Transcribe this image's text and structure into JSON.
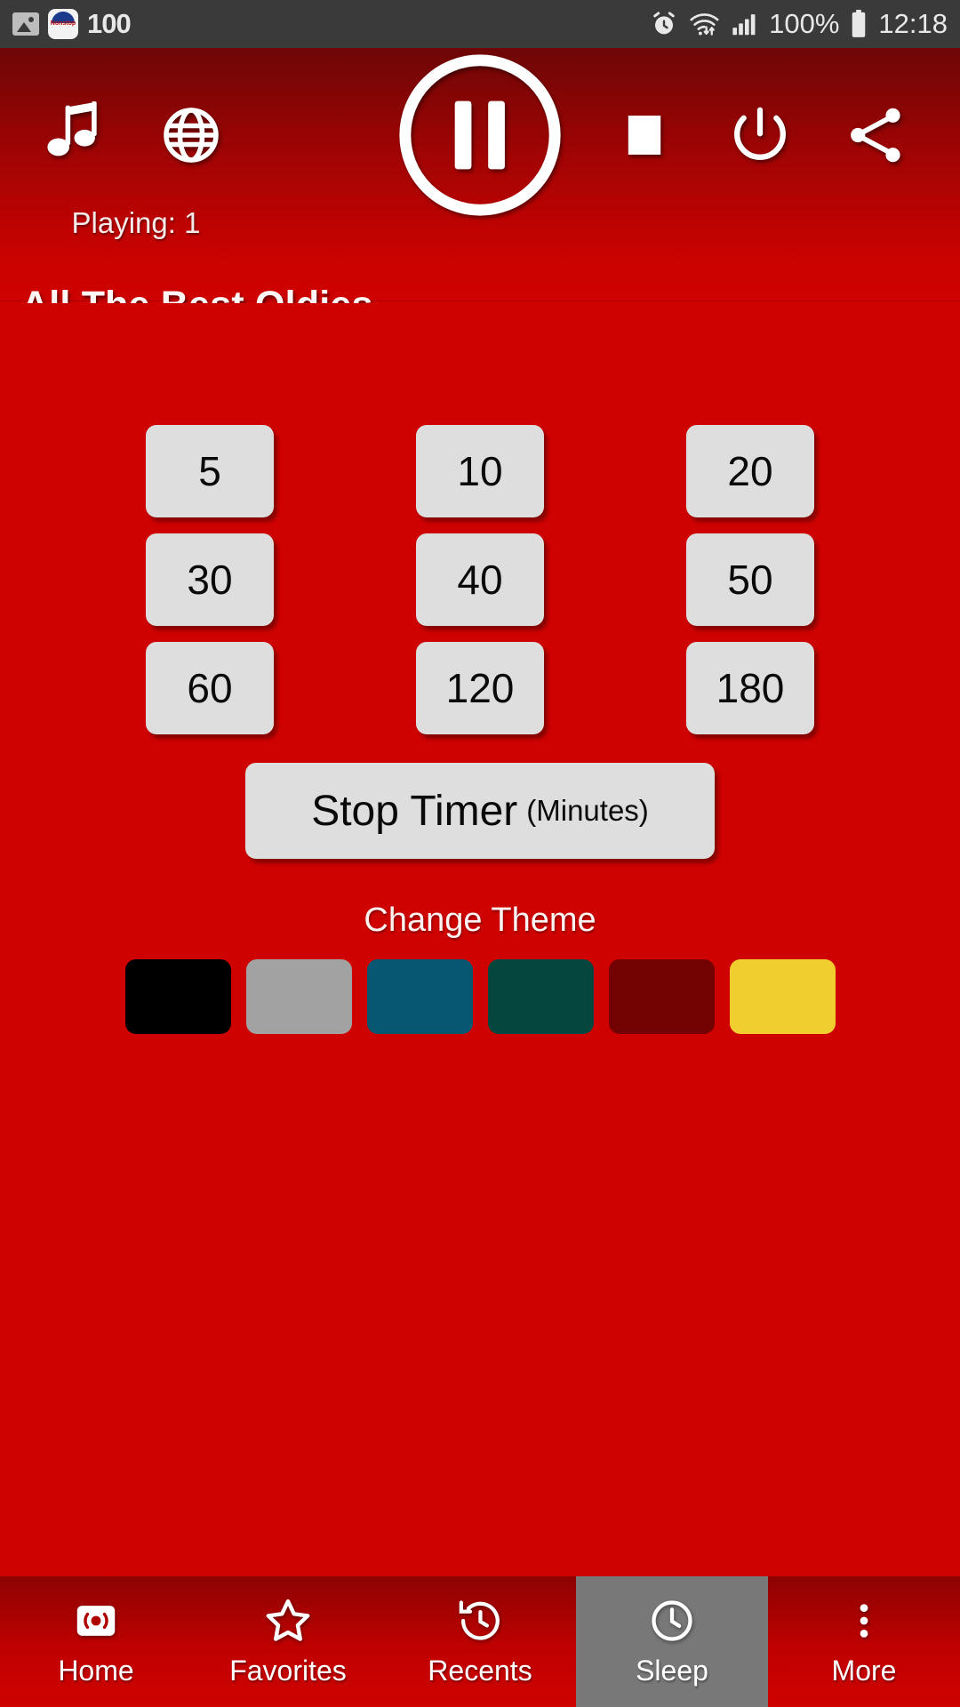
{
  "statusbar": {
    "photo_icon": "photo-icon",
    "app_badge_line1": "Nonstop",
    "app_badge_line2": "Music",
    "notification_count": "100",
    "alarm_icon": "alarm-clock-icon",
    "wifi_icon": "wifi-transfer-icon",
    "signal_icon": "cell-signal-icon",
    "battery_percent": "100%",
    "battery_icon": "battery-full-icon",
    "time": "12:18"
  },
  "player": {
    "music_icon": "music-note-icon",
    "globe_icon": "globe-icon",
    "pause_icon": "pause-circle-icon",
    "stop_icon": "stop-square-icon",
    "power_icon": "power-icon",
    "share_icon": "share-icon",
    "playing_label": "Playing: 1",
    "station_title": "All The Best Oldies"
  },
  "sleep": {
    "timer_values": [
      "5",
      "10",
      "20",
      "30",
      "40",
      "50",
      "60",
      "120",
      "180"
    ],
    "stop_button_main": "Stop Timer",
    "stop_button_sub": "(Minutes)",
    "change_theme_label": "Change Theme",
    "themes": [
      {
        "name": "black",
        "color": "#000000"
      },
      {
        "name": "gray",
        "color": "#A2A2A2"
      },
      {
        "name": "teal",
        "color": "#075772"
      },
      {
        "name": "green",
        "color": "#05463E"
      },
      {
        "name": "maroon",
        "color": "#730303"
      },
      {
        "name": "yellow",
        "color": "#F0CE30"
      }
    ]
  },
  "navbar": {
    "items": [
      {
        "label": "Home",
        "icon": "radio-broadcast-icon",
        "active": false
      },
      {
        "label": "Favorites",
        "icon": "star-icon",
        "active": false
      },
      {
        "label": "Recents",
        "icon": "history-clock-icon",
        "active": false
      },
      {
        "label": "Sleep",
        "icon": "clock-icon",
        "active": true
      },
      {
        "label": "More",
        "icon": "more-vertical-icon",
        "active": false
      }
    ]
  },
  "colors": {
    "background_red": "#CE0200",
    "header_dark_red": "#6E0606",
    "button_gray": "#DEDEDE",
    "active_tab_gray": "#787878",
    "statusbar_dark": "#3A3A3A"
  }
}
